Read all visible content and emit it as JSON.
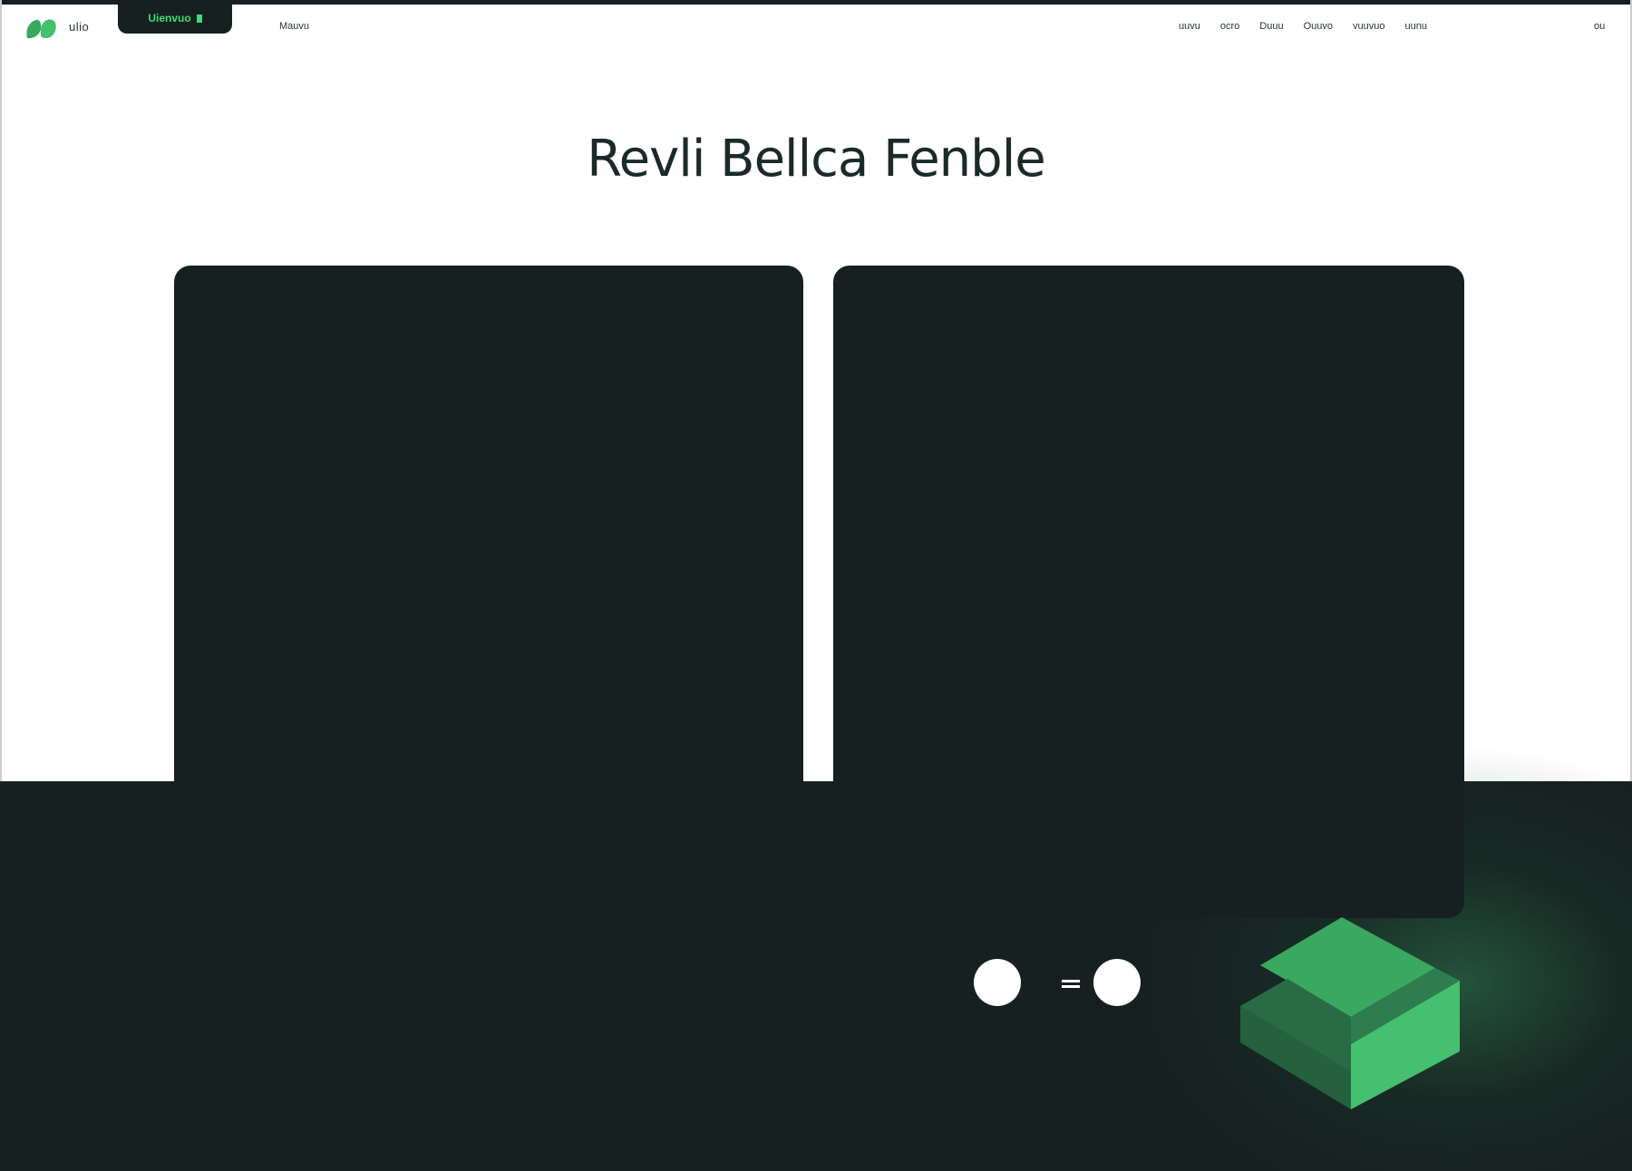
{
  "header": {
    "brand": "ulio",
    "pill_button_label": "Uienvuo",
    "left_link": "Mauvu",
    "nav_links": [
      "uuvu",
      "ocro",
      "Duuu",
      "Ouuvo",
      "vuuvuo",
      "uunu"
    ],
    "right_link": "ou"
  },
  "hero": {
    "title": "Revli Bellca Fenble"
  },
  "colors": {
    "dark": "#162020",
    "accent_green": "#3ddc74",
    "cube_top": "#3aa85e",
    "cube_left": "#2a6a45",
    "cube_right": "#45c06e"
  },
  "icons": {
    "logo": "leaf-logo-icon",
    "toggle": "toggle-switch-icon",
    "cube": "isometric-cube-icon"
  }
}
